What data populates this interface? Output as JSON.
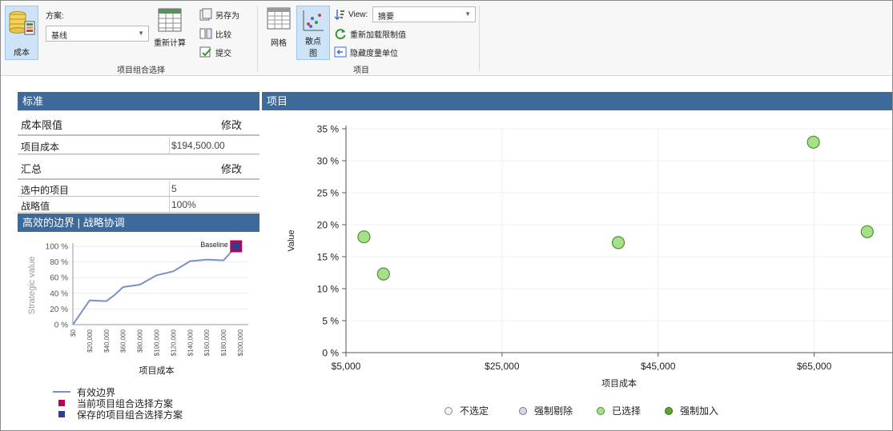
{
  "ribbon": {
    "cost_button_label": "成本",
    "scenario_label": "方案:",
    "scenario_value": "基线",
    "recalc_label": "重新计算",
    "save_as_label": "另存为",
    "compare_label": "比较",
    "submit_label": "提交",
    "group1_label": "项目组合选择",
    "grid_label": "网格",
    "scatter_label_line1": "散点",
    "scatter_label_line2": "图",
    "view_label": "View:",
    "view_value": "摘要",
    "reapply_label": "重新加载限制值",
    "hide_label": "隐藏度量单位",
    "group2_label": "项目"
  },
  "criteria_panel": {
    "title": "标准",
    "cost_limit_label": "成本限值",
    "cost_limit_edit": "修改",
    "project_cost_label": "项目成本",
    "project_cost_value": "$194,500.00",
    "summary_label": "汇总",
    "summary_edit": "修改",
    "selected_projects_label": "选中的项目",
    "selected_projects_value": "5",
    "strategic_value_label": "战略值",
    "strategic_value_value": "100%"
  },
  "frontier_panel": {
    "title": "高效的边界 | 战略协调",
    "legend": [
      {
        "label": "有效边界",
        "color": "#7b8fce"
      },
      {
        "label": "当前项目组合选择方案",
        "color": "#b8005c"
      },
      {
        "label": "保存的项目组合选择方案",
        "color": "#2f3f8f"
      }
    ]
  },
  "projects_panel": {
    "title": "项目",
    "legend": [
      {
        "label": "不选定",
        "color": "#f4f4f4"
      },
      {
        "label": "强制剔除",
        "color": "#d5d7e3"
      },
      {
        "label": "已选择",
        "color": "#a6e08a"
      },
      {
        "label": "强制加入",
        "color": "#5fa434"
      }
    ]
  },
  "chart_data": [
    {
      "type": "line",
      "xlabel": "项目成本",
      "ylabel": "Strategic value",
      "x_tick_labels": [
        "$0",
        "$20,000",
        "$40,000",
        "$60,000",
        "$80,000",
        "$100,000",
        "$120,000",
        "$140,000",
        "$160,000",
        "$180,000",
        "$200,000"
      ],
      "y_tick_labels": [
        "0 %",
        "20 %",
        "40 %",
        "60 %",
        "80 %",
        "100 %"
      ],
      "xlim": [
        0,
        200000
      ],
      "ylim": [
        0,
        100
      ],
      "series": [
        {
          "name": "有效边界",
          "x": [
            0,
            20000,
            40000,
            50000,
            60000,
            80000,
            100000,
            120000,
            140000,
            160000,
            180000,
            195000
          ],
          "y": [
            0,
            31,
            30,
            38,
            48,
            51,
            63,
            68,
            81,
            83,
            82,
            100
          ]
        }
      ],
      "markers": [
        {
          "label": "Baseline",
          "x": 195000,
          "y": 100
        }
      ]
    },
    {
      "type": "scatter",
      "xlabel": "项目成本",
      "ylabel": "Value",
      "x_tick_labels": [
        "$5,000",
        "$25,000",
        "$45,000",
        "$65,000"
      ],
      "y_tick_labels": [
        "0 %",
        "5 %",
        "10 %",
        "15 %",
        "20 %",
        "25 %",
        "30 %",
        "35 %"
      ],
      "xlim": [
        5000,
        75000
      ],
      "ylim": [
        0,
        35
      ],
      "grid": true,
      "points": [
        {
          "x": 7300,
          "y": 18.1
        },
        {
          "x": 9800,
          "y": 12.3
        },
        {
          "x": 39900,
          "y": 17.2
        },
        {
          "x": 64900,
          "y": 32.9
        },
        {
          "x": 71800,
          "y": 18.9
        }
      ]
    }
  ]
}
